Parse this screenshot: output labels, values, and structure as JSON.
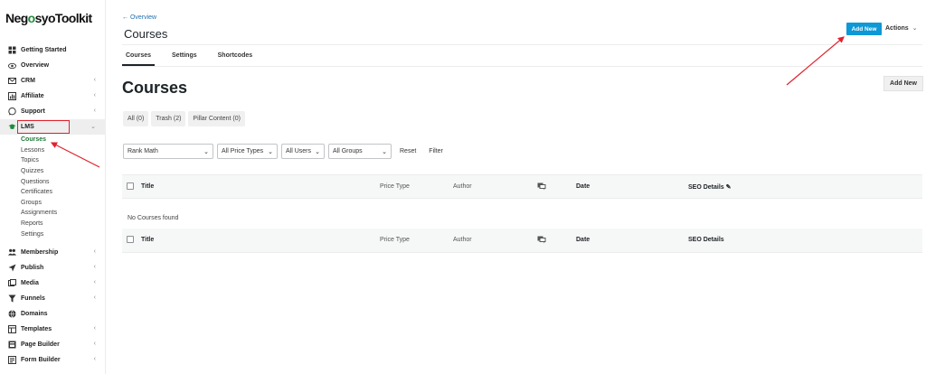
{
  "app": {
    "logo_text_1": "Neg",
    "logo_o": "o",
    "logo_text_2": "syoToolkit"
  },
  "sidebar": {
    "items_top": [
      {
        "label": "Getting Started",
        "icon": "grid-icon"
      },
      {
        "label": "Overview",
        "icon": "eye-icon"
      },
      {
        "label": "CRM",
        "icon": "mail-icon",
        "chevron": "‹"
      },
      {
        "label": "Affiliate",
        "icon": "bar-chart-icon",
        "chevron": "‹"
      },
      {
        "label": "Support",
        "icon": "chat-icon",
        "chevron": "‹"
      }
    ],
    "lms": {
      "label": "LMS",
      "icon": "graduation-cap-icon",
      "chevron": "⌄"
    },
    "lms_sub": [
      "Courses",
      "Lessons",
      "Topics",
      "Quizzes",
      "Questions",
      "Certificates",
      "Groups",
      "Assignments",
      "Reports",
      "Settings"
    ],
    "items_bottom": [
      {
        "label": "Membership",
        "icon": "users-icon",
        "chevron": "‹"
      },
      {
        "label": "Publish",
        "icon": "send-icon",
        "chevron": "‹"
      },
      {
        "label": "Media",
        "icon": "media-icon",
        "chevron": "‹"
      },
      {
        "label": "Funnels",
        "icon": "funnel-icon",
        "chevron": "‹"
      },
      {
        "label": "Domains",
        "icon": "globe-icon"
      },
      {
        "label": "Templates",
        "icon": "template-icon",
        "chevron": "‹"
      },
      {
        "label": "Page Builder",
        "icon": "page-icon",
        "chevron": "‹"
      },
      {
        "label": "Form Builder",
        "icon": "form-icon",
        "chevron": "‹"
      }
    ]
  },
  "header": {
    "back_link": "← Overview",
    "page_title": "Courses",
    "add_new": "Add New",
    "actions": "Actions",
    "tabs": [
      "Courses",
      "Settings",
      "Shortcodes"
    ]
  },
  "content": {
    "heading": "Courses",
    "add_new": "Add New",
    "filter_tabs": [
      "All (0)",
      "Trash (2)",
      "Pillar Content (0)"
    ],
    "selects": [
      "Rank Math",
      "All Price Types",
      "All Users",
      "All Groups"
    ],
    "reset": "Reset",
    "filter": "Filter",
    "columns": {
      "title": "Title",
      "price_type": "Price Type",
      "author": "Author",
      "date": "Date",
      "seo_details": "SEO Details"
    },
    "empty_message": "No Courses found"
  },
  "colors": {
    "accent": "#0d98d6",
    "active_green": "#1f7a3a",
    "annotation_red": "#e0222e"
  }
}
